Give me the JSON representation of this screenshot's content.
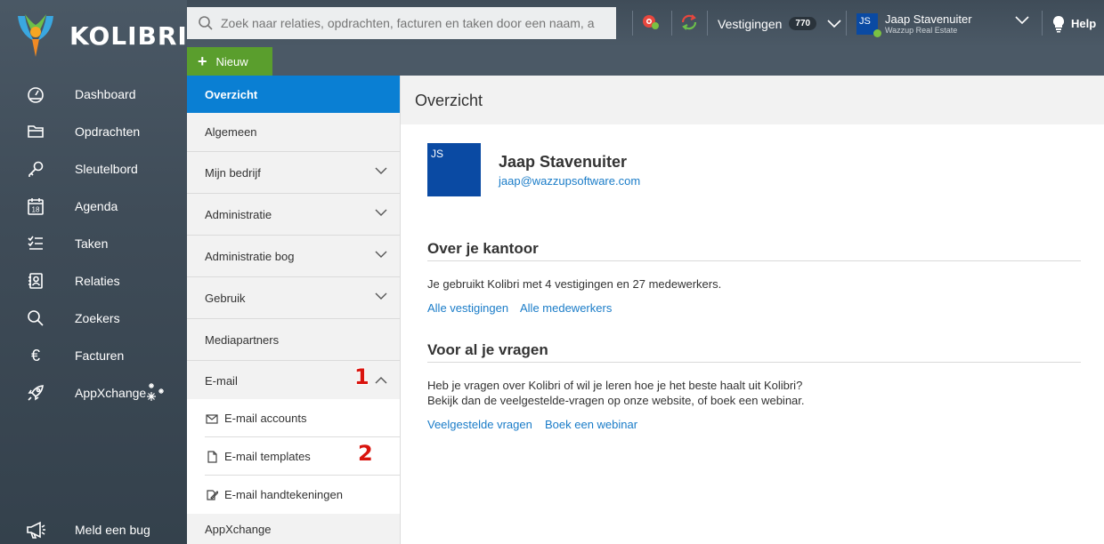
{
  "app": {
    "name": "KOLIBRI"
  },
  "sidebar": {
    "items": [
      {
        "label": "Dashboard",
        "icon": "dashboard-icon"
      },
      {
        "label": "Opdrachten",
        "icon": "folder-icon"
      },
      {
        "label": "Sleutelbord",
        "icon": "key-icon"
      },
      {
        "label": "Agenda",
        "icon": "calendar-icon"
      },
      {
        "label": "Taken",
        "icon": "checklist-icon"
      },
      {
        "label": "Relaties",
        "icon": "contacts-icon"
      },
      {
        "label": "Zoekers",
        "icon": "search-icon"
      },
      {
        "label": "Facturen",
        "icon": "euro-icon"
      },
      {
        "label": "AppXchange",
        "icon": "rocket-icon"
      }
    ],
    "calendar_day": "18",
    "euro_symbol": "€",
    "bug_label": "Meld een bug"
  },
  "topbar": {
    "search_placeholder": "Zoek naar relaties, opdrachten, facturen en taken door een naam, a",
    "vestigingen_label": "Vestigingen",
    "vestigingen_count": "770",
    "user_initials": "JS",
    "user_name": "Jaap Stavenuiter",
    "user_company": "Wazzup Real Estate",
    "help_label": "Help"
  },
  "new_button": {
    "label": "Nieuw"
  },
  "settings_menu": {
    "items": [
      {
        "label": "Overzicht",
        "active": true,
        "chevron": ""
      },
      {
        "label": "Algemeen",
        "chevron": ""
      },
      {
        "label": "Mijn bedrijf",
        "chevron": "down"
      },
      {
        "label": "Administratie",
        "chevron": "down"
      },
      {
        "label": "Administratie bog",
        "chevron": "down"
      },
      {
        "label": "Gebruik",
        "chevron": "down"
      },
      {
        "label": "Mediapartners",
        "chevron": ""
      },
      {
        "label": "E-mail",
        "chevron": "up"
      }
    ],
    "email_subitems": [
      {
        "label": "E-mail accounts",
        "icon": "envelope-icon"
      },
      {
        "label": "E-mail templates",
        "icon": "document-icon"
      },
      {
        "label": "E-mail handtekeningen",
        "icon": "signature-icon"
      }
    ],
    "last_item": "AppXchange",
    "markers": [
      "1",
      "2"
    ]
  },
  "content": {
    "title": "Overzicht",
    "profile": {
      "initials": "JS",
      "name": "Jaap Stavenuiter",
      "email": "jaap@wazzupsoftware.com"
    },
    "office": {
      "title": "Over je kantoor",
      "text": "Je gebruikt Kolibri met 4 vestigingen en 27 medewerkers.",
      "link_branches": "Alle vestigingen",
      "link_employees": "Alle medewerkers"
    },
    "questions": {
      "title": "Voor al je vragen",
      "line1": "Heb je vragen over Kolibri of wil je leren hoe je het beste haalt uit Kolibri?",
      "line2": "Bekijk dan de veelgestelde-vragen op onze website, of boek een webinar.",
      "link_faq": "Veelgestelde vragen",
      "link_webinar": "Boek een webinar"
    }
  },
  "colors": {
    "sidebar_bg": "#3f4c58",
    "active_blue": "#0a7fd3",
    "new_green": "#5a9e2d",
    "link_blue": "#1a7cc8",
    "avatar_blue": "#0a4aa3",
    "marker_red": "#d9140e"
  }
}
